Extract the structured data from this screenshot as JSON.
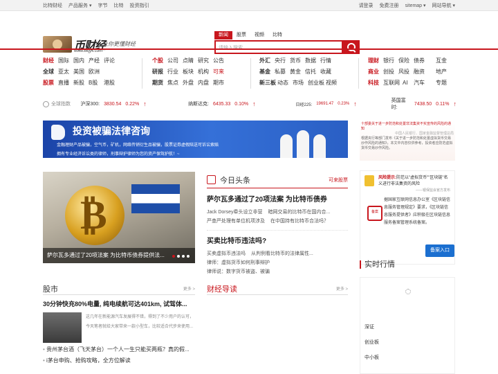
{
  "topbar": {
    "left": [
      "比特财经",
      "产品服务 ▾",
      "字节",
      "比特",
      "投资指引"
    ],
    "right": [
      "请登录",
      "免费注册",
      "sitemap ▾",
      "网站导航 ▾"
    ]
  },
  "logo": {
    "brand": "币财经",
    "slogan": "让你更懂财经",
    "url": "www.bitjys.com"
  },
  "search": {
    "tabs": [
      "新闻",
      "股票",
      "视频",
      "比特"
    ],
    "placeholder": "请输入搜索..."
  },
  "nav": [
    {
      "rows": [
        [
          "财经",
          "国际",
          "国内",
          "产经",
          "评论"
        ],
        [
          "全球",
          "亚太",
          "美国",
          "欧洲"
        ],
        [
          "股票",
          "直播",
          "新股",
          "B股",
          "港股"
        ]
      ]
    },
    {
      "rows": [
        [
          "个股",
          "公司",
          "点睛",
          "研究",
          "公告"
        ],
        [
          "研报",
          "行业",
          "板块",
          "机构",
          "可来"
        ],
        [
          "期货",
          "焦点",
          "外盘",
          "内盘",
          "期市"
        ]
      ]
    },
    {
      "rows": [
        [
          "外汇",
          "央行",
          "货币",
          "数据",
          "行情"
        ],
        [
          "基金",
          "私募",
          "黄金",
          "信托",
          "收藏"
        ],
        [
          "新三板",
          "动态",
          "市场",
          "创业板",
          "视频"
        ]
      ]
    },
    {
      "rows": [
        [
          "理财",
          "银行",
          "保险",
          "债券",
          "互金"
        ],
        [
          "商业",
          "创投",
          "风投",
          "融资",
          "地产"
        ],
        [
          "科技",
          "互联网",
          "AI",
          "汽车",
          "专题"
        ]
      ]
    }
  ],
  "ticker": {
    "label": "全球指数",
    "items": [
      {
        "name": "沪深300:",
        "value": "3830.54",
        "pct": "0.22%"
      },
      {
        "name": "纳斯达克:",
        "value": "6435.33",
        "pct": "0.10%"
      },
      {
        "name": "日经225:",
        "value": "19691.47",
        "pct": "0.23%"
      },
      {
        "name": "英国富时:",
        "value": "7438.50",
        "pct": "0.11%"
      }
    ]
  },
  "banner": {
    "title": "投资被骗法律咨询",
    "line1": "金融理财产品被骗，空气币，矿机，网络传销衍生品被骗，股票证券虚假陪送可诉讼索赔",
    "line2": "拥有专业经济诉讼类的律师，刑事辩护律师为您的资产保驾护航！~"
  },
  "notice": {
    "text": "十部委关于进一步防范和处置非法集资不实宣传的风险的通知",
    "src": "中国人民银行、国家金融监督管理总局",
    "body": "根据央行等部门发布《关于进一步防范和处置虚拟货币交易炒作风险的通知》，本文中内容仅供参考，投资者应防范虚拟货币交易炒作风险。"
  },
  "warn": {
    "title": "风险提示:",
    "text": "防范以\"虚拟货币\"\"区块链\"名义进行非法集资的风险",
    "src": "——银保监会官方发布",
    "body": "据国家互联网信息办公室《区块链信息服务管理规定》要求，《区块链信息服务提供者》应积极在区块链信息服务备案管理系统备案。",
    "seal": "备案",
    "btn": "备案入口"
  },
  "quotes": {
    "title": "实时行情",
    "rows": [
      "深证",
      "创业板",
      "中小板"
    ]
  },
  "hero": {
    "caption": "萨尔瓦多通过了20项法案 为比特币债券提供法..."
  },
  "today": {
    "title": "今日头条",
    "more": "可来股票",
    "h1": "萨尔瓦多通过了20项法案 为比特币债券",
    "l1": [
      [
        "Jack Dorsey牵头设立非营",
        "暗网交易的比特币在国内合..."
      ],
      [
        "严查严处理有单位机项涉及",
        "在中国持有比特币合法吗？"
      ]
    ],
    "h2": "买卖比特币违法吗?",
    "l2": [
      [
        "买卖虚拟币违法吗",
        "从判例看比特币的法律属性..."
      ],
      [
        "律师：虚拟货币如何刑事辩护",
        ""
      ],
      [
        "律师说：数字货币被盗、被骗",
        ""
      ]
    ]
  },
  "stock": {
    "title": "股市",
    "more": "更多 >",
    "headline": "30分钟快充80%电量, 纯电续航可达401km, 试驾体...",
    "desc": "这几年在新能源汽车发展得不错，得到了不少用户的认可，今天笔者就给大家带来一款小型车，比较适合代步来使用...",
    "bullets": [
      "贵州茅台酒（飞天茅台）一个人一生只能买两瓶？真的假...",
      "i茅台申购、抢购攻略，全方位解读"
    ]
  },
  "guide": {
    "title": "财经导读",
    "more": "更多 >"
  }
}
